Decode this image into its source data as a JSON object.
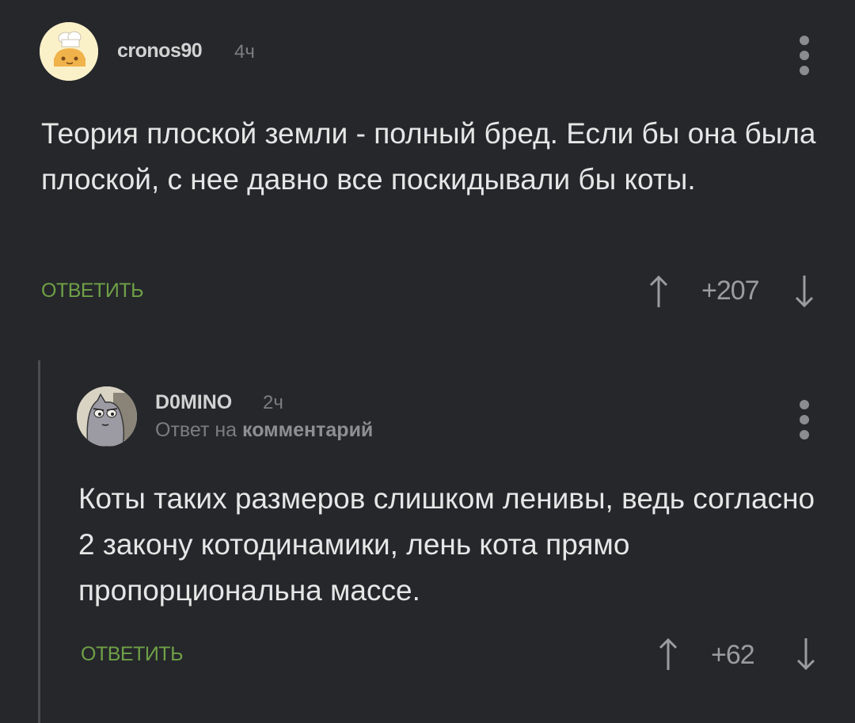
{
  "comments": [
    {
      "username": "cronos90",
      "time": "4ч",
      "text": "Теория плоской земли - полный бред. Если бы она была плоской, с нее давно все поскидывали бы коты.",
      "reply_label": "ОТВЕТИТЬ",
      "score": "+207"
    },
    {
      "username": "D0MINO",
      "time": "2ч",
      "reply_to_prefix": "Ответ на",
      "reply_to_link": "комментарий",
      "text": "Коты таких размеров слишком ленивы, ведь согласно 2 закону котодинамики, лень кота прямо пропорциональна массе.",
      "reply_label": "ОТВЕТИТЬ",
      "score": "+62"
    }
  ],
  "colors": {
    "background": "#25272b",
    "reply_link": "#6fa046",
    "thread_line": "#4a4c51"
  },
  "icons": [
    "more-vertical-icon",
    "arrow-up-icon",
    "arrow-down-icon"
  ]
}
